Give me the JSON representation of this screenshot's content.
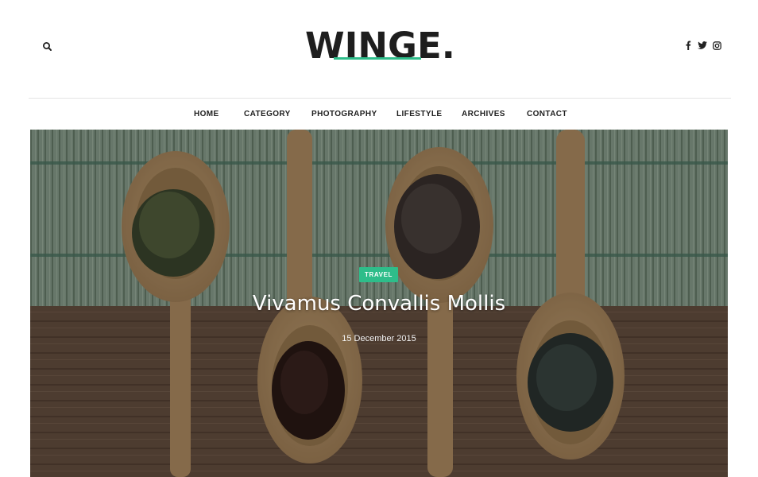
{
  "header": {
    "logo_text": "WINGE",
    "logo_dot": ".",
    "search_icon": "search-icon",
    "social": [
      {
        "icon": "facebook-icon"
      },
      {
        "icon": "twitter-icon"
      },
      {
        "icon": "instagram-icon"
      }
    ]
  },
  "nav": {
    "items": [
      {
        "label": "HOME"
      },
      {
        "label": "CATEGORY"
      },
      {
        "label": "PHOTOGRAPHY"
      },
      {
        "label": "LIFESTYLE"
      },
      {
        "label": "ARCHIVES"
      },
      {
        "label": "CONTACT"
      }
    ]
  },
  "hero": {
    "category": "TRAVEL",
    "title": "Vivamus Convallis Mollis",
    "date": "15 December 2015",
    "image": "wooden-spoons-with-spices-image"
  },
  "colors": {
    "accent": "#2ebd8a",
    "text": "#1e1e1e"
  }
}
